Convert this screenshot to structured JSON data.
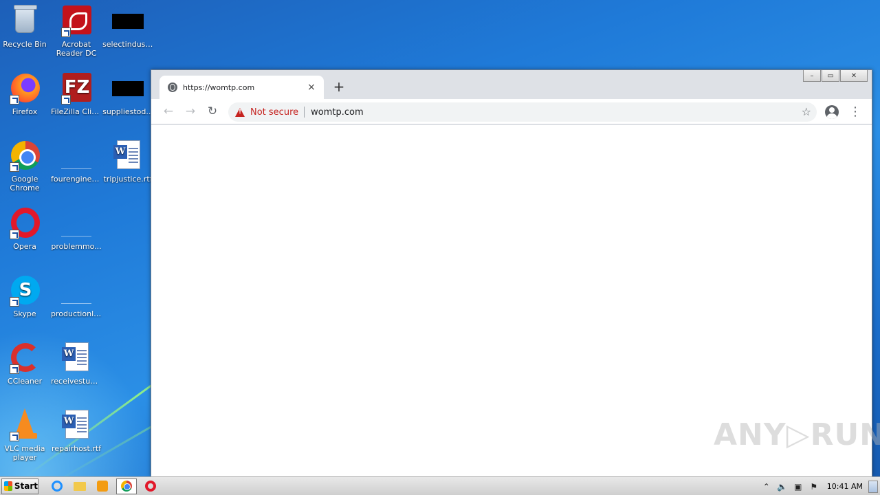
{
  "desktop": {
    "icons": [
      {
        "label": "Recycle Bin"
      },
      {
        "label": "Acrobat Reader DC"
      },
      {
        "label": "selectindust..."
      },
      {
        "label": "Firefox"
      },
      {
        "label": "FileZilla Client"
      },
      {
        "label": "suppliestod..."
      },
      {
        "label": "Google Chrome"
      },
      {
        "label": "fourenginee..."
      },
      {
        "label": "tripjustice.rtf"
      },
      {
        "label": "Opera"
      },
      {
        "label": "problemmo..."
      },
      {
        "label": "Skype"
      },
      {
        "label": "productionlo..."
      },
      {
        "label": "CCleaner"
      },
      {
        "label": "receivestud..."
      },
      {
        "label": "VLC media player"
      },
      {
        "label": "repairhost.rtf"
      }
    ]
  },
  "browser": {
    "tab_title": "https://womtp.com",
    "tab_close": "×",
    "new_tab": "+",
    "back": "←",
    "forward": "→",
    "reload": "↻",
    "security_label": "Not secure",
    "url": "womtp.com",
    "star": "☆",
    "menu": "⋮",
    "caption": {
      "minimize": "–",
      "maximize": "▭",
      "close": "✕"
    }
  },
  "watermark": "ANY▷RUN",
  "taskbar": {
    "start_label": "Start",
    "clock": "10:41 AM",
    "tray": [
      "⌃",
      "🔈",
      "▣",
      "⚑"
    ]
  }
}
